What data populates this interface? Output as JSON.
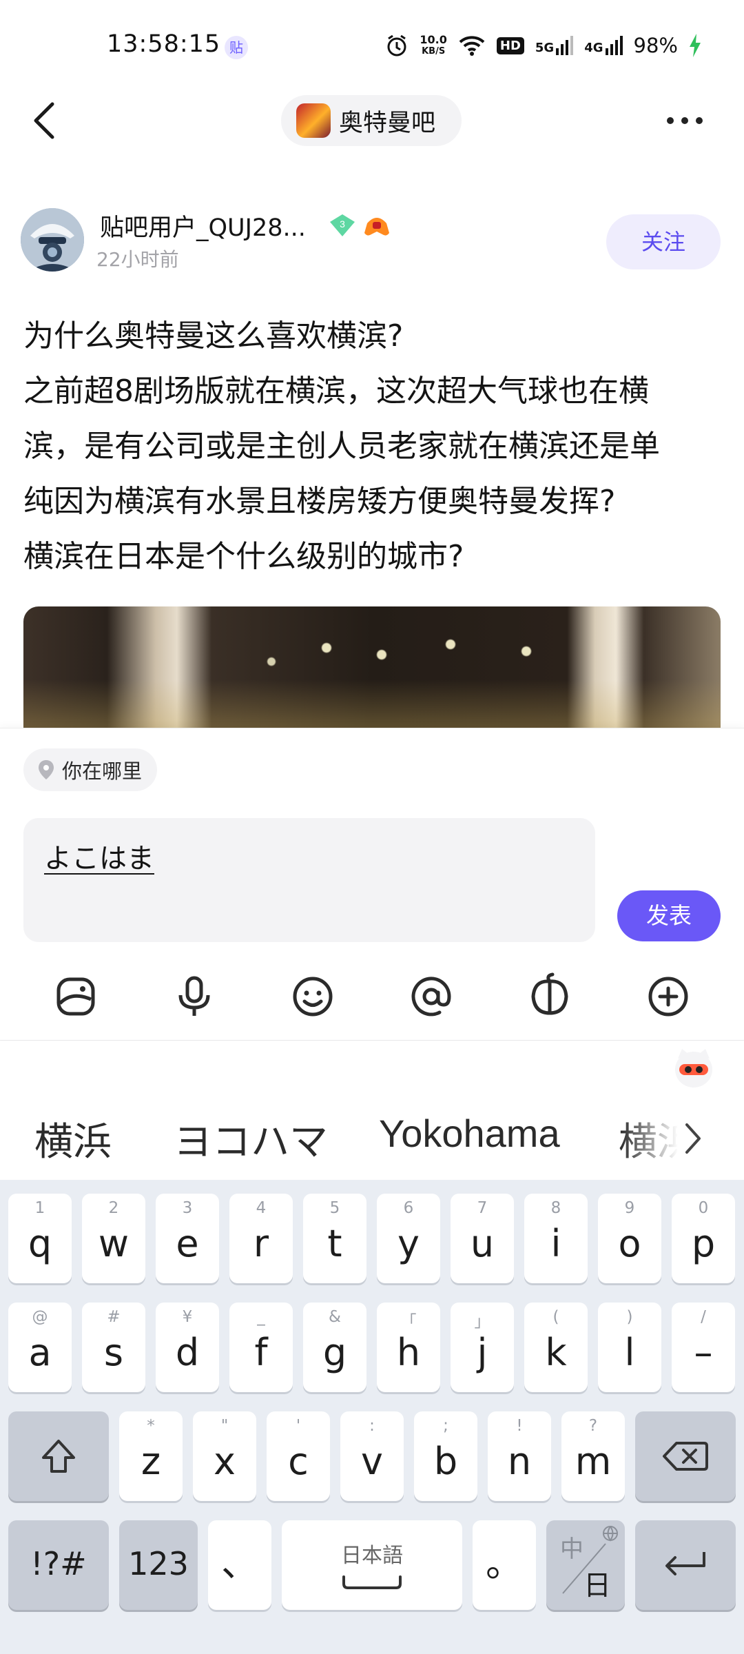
{
  "status_bar": {
    "time": "13:58:15",
    "notif_icon_label": "贴",
    "net_speed_top": "10.0",
    "net_speed_bottom": "KB/S",
    "hd_label": "HD",
    "signal_5g": "5G",
    "signal_4g": "4G",
    "battery": "98%"
  },
  "header": {
    "forum_name": "奥特曼吧"
  },
  "post": {
    "username": "贴吧用户_QUJ28...",
    "level": "3",
    "time_ago": "22小时前",
    "follow_label": "关注",
    "lines": [
      "为什么奥特曼这么喜欢横滨?",
      "之前超8剧场版就在横滨，这次超大气球也在横",
      "滨，是有公司或是主创人员老家就在横滨还是单",
      "纯因为横滨有水景且楼房矮方便奥特曼发挥?",
      "横滨在日本是个什么级别的城市?"
    ]
  },
  "reply": {
    "location_label": "你在哪里",
    "input_value": "よこはま",
    "send_label": "发表",
    "tool_icons": [
      "image-icon",
      "microphone-icon",
      "emoji-icon",
      "at-mention-icon",
      "gift-icon",
      "plus-icon"
    ]
  },
  "ime": {
    "suggestions": [
      "横浜",
      "ヨコハマ",
      "Yokohama",
      "横浜"
    ],
    "row1": [
      {
        "hint": "1",
        "ch": "q"
      },
      {
        "hint": "2",
        "ch": "w"
      },
      {
        "hint": "3",
        "ch": "e"
      },
      {
        "hint": "4",
        "ch": "r"
      },
      {
        "hint": "5",
        "ch": "t"
      },
      {
        "hint": "6",
        "ch": "y"
      },
      {
        "hint": "7",
        "ch": "u"
      },
      {
        "hint": "8",
        "ch": "i"
      },
      {
        "hint": "9",
        "ch": "o"
      },
      {
        "hint": "0",
        "ch": "p"
      }
    ],
    "row2": [
      {
        "hint": "@",
        "ch": "a"
      },
      {
        "hint": "#",
        "ch": "s"
      },
      {
        "hint": "¥",
        "ch": "d"
      },
      {
        "hint": "_",
        "ch": "f"
      },
      {
        "hint": "&",
        "ch": "g"
      },
      {
        "hint": "「",
        "ch": "h"
      },
      {
        "hint": "」",
        "ch": "j"
      },
      {
        "hint": "(",
        "ch": "k"
      },
      {
        "hint": ")",
        "ch": "l"
      },
      {
        "hint": "/",
        "ch": "–"
      }
    ],
    "row3": [
      {
        "hint": "*",
        "ch": "z"
      },
      {
        "hint": "\"",
        "ch": "x"
      },
      {
        "hint": "'",
        "ch": "c"
      },
      {
        "hint": ":",
        "ch": "v"
      },
      {
        "hint": ";",
        "ch": "b"
      },
      {
        "hint": "!",
        "ch": "n"
      },
      {
        "hint": "?",
        "ch": "m"
      }
    ],
    "symbols_label": "!?#",
    "numbers_label": "123",
    "comma_label": "、",
    "space_label": "日本語",
    "period_label": "。",
    "lang_top": "中",
    "lang_bottom": "日"
  }
}
